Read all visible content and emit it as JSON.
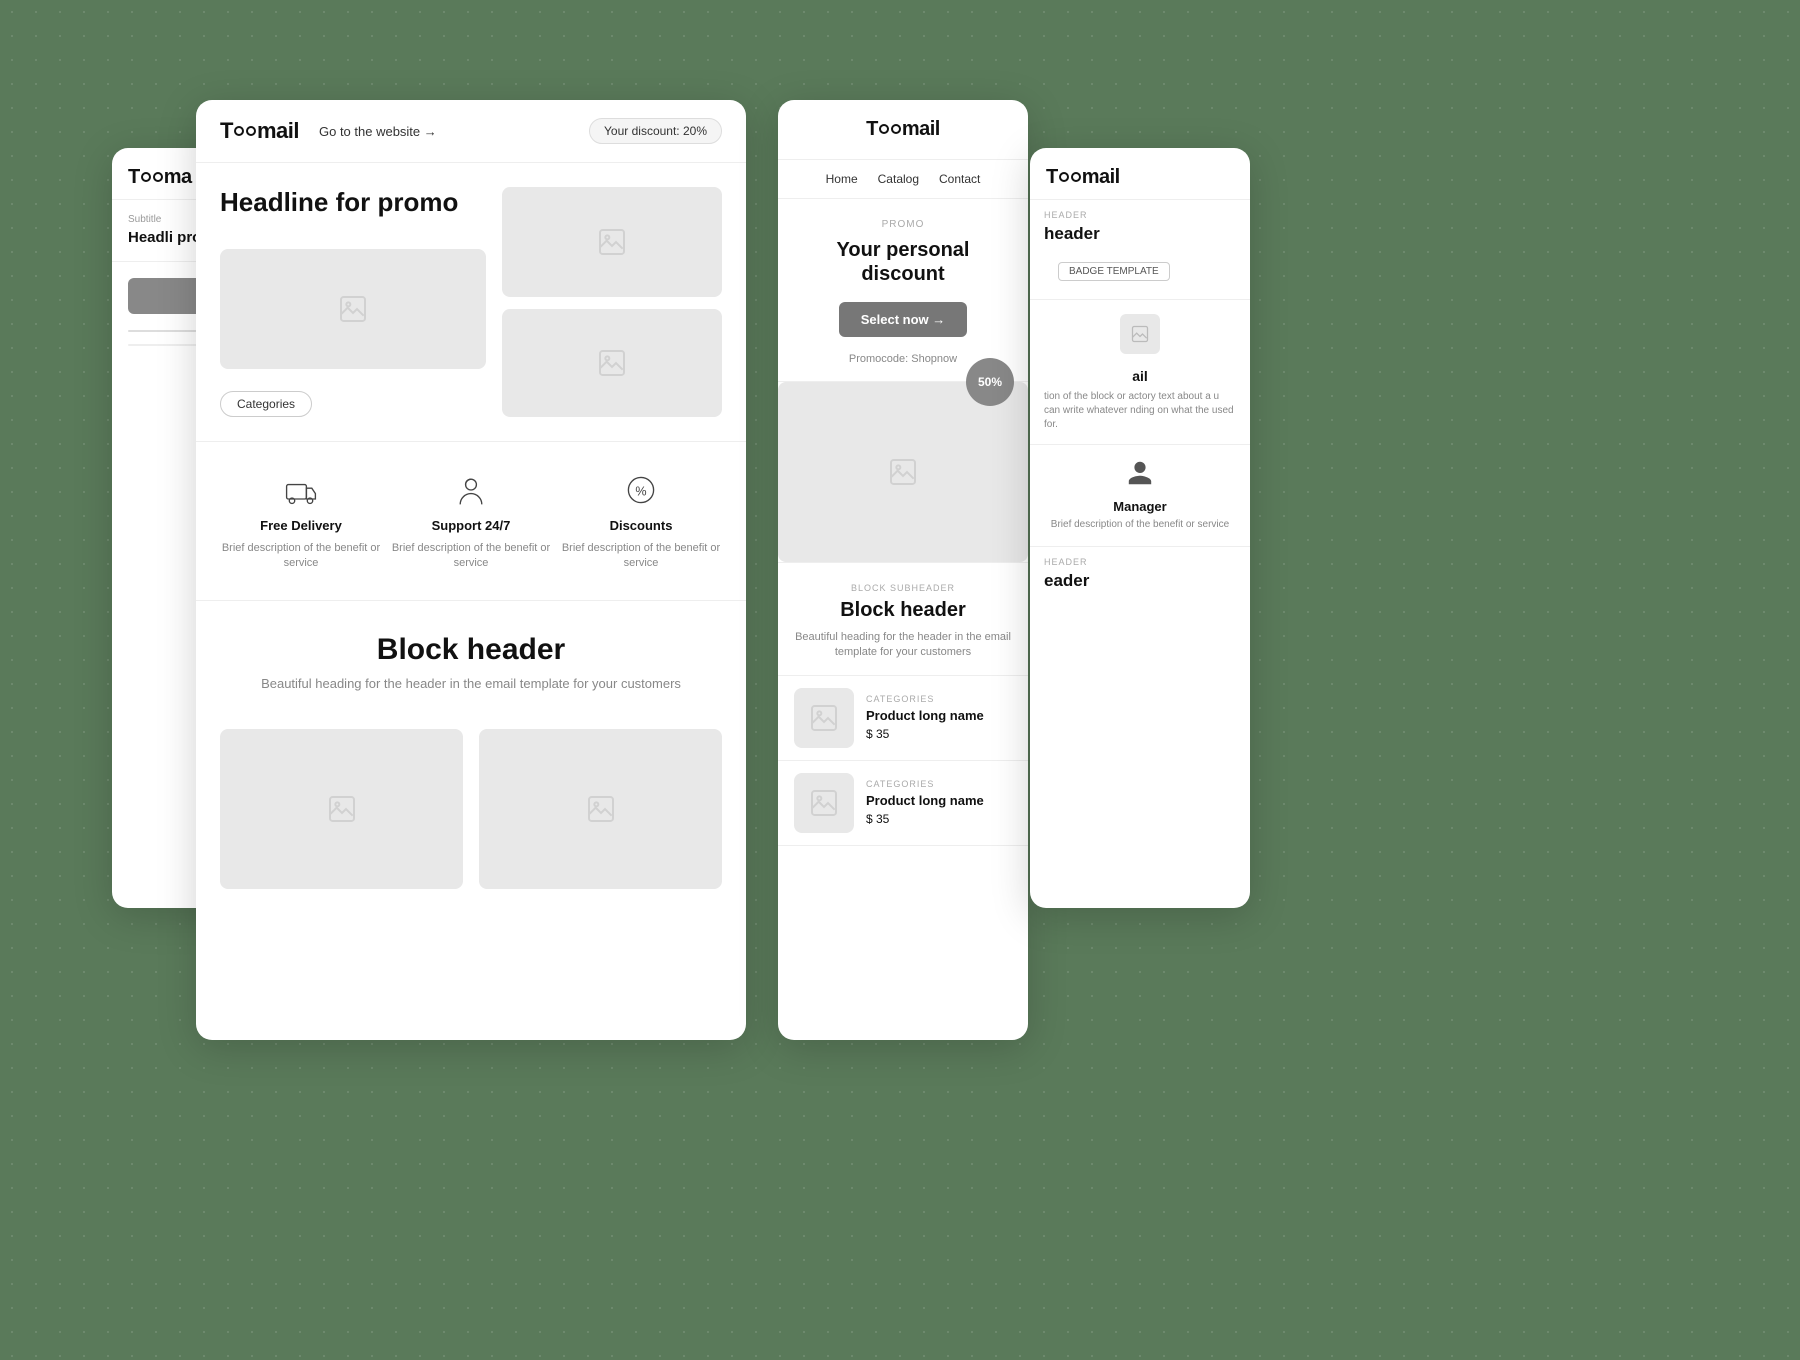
{
  "background": {
    "color": "#5a7a5a"
  },
  "cards": {
    "left_partial": {
      "logo": "Toomail",
      "subtitle_label": "Subtitle",
      "headline": "Headli promo",
      "button_label": "",
      "bars": []
    },
    "center": {
      "header": {
        "logo": "Toomail",
        "goto_link": "Go to the website →",
        "discount_badge": "Your discount: 20%"
      },
      "hero": {
        "headline": "Headline for promo",
        "categories_button": "Categories"
      },
      "benefits": [
        {
          "icon": "delivery",
          "title": "Free Delivery",
          "description": "Brief description of the benefit or service"
        },
        {
          "icon": "support",
          "title": "Support 24/7",
          "description": "Brief description of the benefit or service"
        },
        {
          "icon": "discount",
          "title": "Discounts",
          "description": "Brief description of the benefit or service"
        }
      ],
      "block_header": {
        "title": "Block header",
        "subtitle": "Beautiful heading for the header in the email template for your customers"
      }
    },
    "right": {
      "logo": "Toomail",
      "nav": [
        "Home",
        "Catalog",
        "Contact"
      ],
      "promo": {
        "label": "PROMO",
        "headline": "Your personal discount",
        "button": "Select now →",
        "promocode": "Promocode: Shopnow",
        "discount_circle": "50%"
      },
      "block_header": {
        "sub_label": "BLOCK SUBHEADER",
        "title": "Block header",
        "subtitle": "Beautiful heading for the header in the email template for your customers"
      },
      "products": [
        {
          "category": "CATEGORIES",
          "name": "Product long name",
          "price": "$ 35"
        },
        {
          "category": "CATEGORIES",
          "name": "Product long name",
          "price": "$ 35"
        }
      ]
    },
    "far_right_partial": {
      "logo": "Toomail",
      "section_label": "HEADER",
      "header_text": "header",
      "badge": "BADGE TEMPLATE",
      "mail_text": "ail",
      "description": "tion of the block or actory text about a u can write whatever nding on what the used for.",
      "manager": {
        "name": "Manager",
        "description": "Brief description of the benefit or service"
      },
      "section_label2": "HEADER",
      "header_text2": "eader"
    }
  }
}
